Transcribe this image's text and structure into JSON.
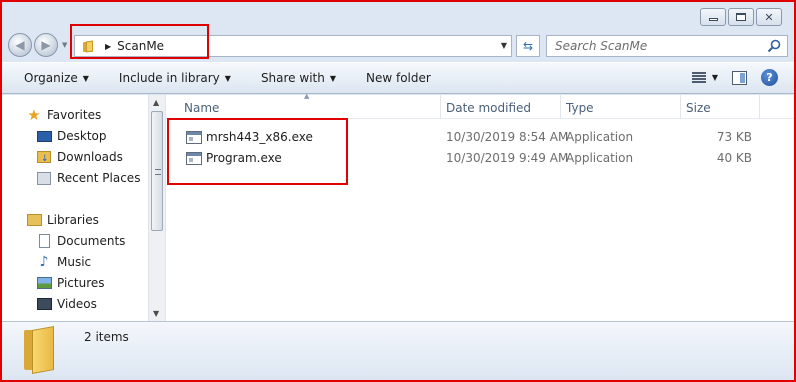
{
  "window": {
    "caption_buttons": [
      {
        "name": "minimize",
        "icon": "minimize-icon"
      },
      {
        "name": "maximize",
        "icon": "maximize-icon"
      },
      {
        "name": "close",
        "icon": "close-icon",
        "glyph": "✕"
      }
    ]
  },
  "address": {
    "path": "ScanMe",
    "search_placeholder": "Search ScanMe"
  },
  "toolbar": {
    "organize": "Organize",
    "include_in_library": "Include in library",
    "share_with": "Share with",
    "new_folder": "New folder"
  },
  "nav": {
    "favorites_header": "Favorites",
    "favorites": [
      "Desktop",
      "Downloads",
      "Recent Places"
    ],
    "libraries_header": "Libraries",
    "libraries": [
      "Documents",
      "Music",
      "Pictures",
      "Videos"
    ]
  },
  "columns": {
    "name": "Name",
    "date_modified": "Date modified",
    "type": "Type",
    "size": "Size"
  },
  "files": [
    {
      "name": "mrsh443_x86.exe",
      "date_modified": "10/30/2019 8:54 AM",
      "type": "Application",
      "size": "73 KB"
    },
    {
      "name": "Program.exe",
      "date_modified": "10/30/2019 9:49 AM",
      "type": "Application",
      "size": "40 KB"
    }
  ],
  "details": {
    "item_count": "2 items"
  },
  "colors": {
    "annotation_red": "#e00000",
    "chrome_blue": "#dde7f3",
    "header_text": "#4c607a"
  }
}
